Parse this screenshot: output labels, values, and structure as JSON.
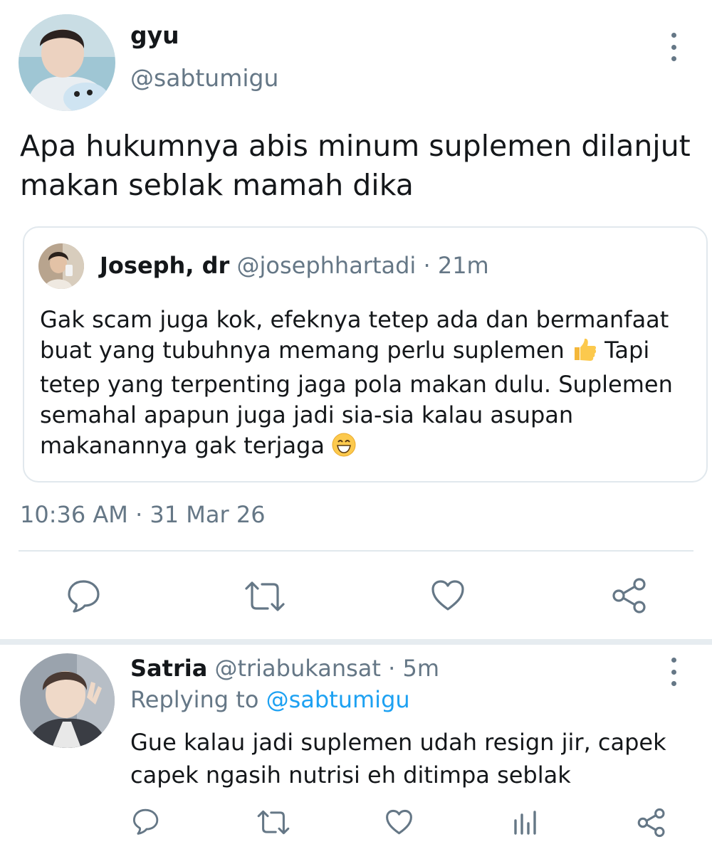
{
  "main_tweet": {
    "display_name": "gyu",
    "handle": "@sabtumigu",
    "text": "Apa hukumnya abis minum suplemen dilanjut makan seblak mamah dika",
    "timestamp": "10:36 AM · 31 Mar 26"
  },
  "quoted_tweet": {
    "display_name": "Joseph, dr",
    "handle": "@josephhartadi",
    "separator": " · ",
    "time_ago": "21m",
    "text_part1": "Gak scam juga kok, efeknya tetep ada dan bermanfaat buat yang tubuhnya memang perlu suplemen ",
    "emoji_1": "thumbs-up-emoji",
    "text_part2": " Tapi tetep yang terpenting jaga pola makan dulu. Suplemen semahal apapun juga jadi sia-sia kalau asupan makanannya gak terjaga ",
    "emoji_2": "grinning-face-emoji"
  },
  "reply_tweet": {
    "display_name": "Satria",
    "handle": "@triabukansat",
    "separator": " · ",
    "time_ago": "5m",
    "replying_prefix": "Replying to ",
    "replying_handle": "@sabtumigu",
    "text": "Gue kalau jadi suplemen udah resign jir, capek capek ngasih nutrisi eh ditimpa seblak"
  },
  "icons": {
    "reply": "reply-icon",
    "retweet": "retweet-icon",
    "like": "heart-icon",
    "share": "share-icon",
    "analytics": "analytics-icon",
    "more": "more-vertical-icon"
  },
  "colors": {
    "text_primary": "#14171a",
    "text_secondary": "#657786",
    "link": "#1da1f2",
    "border": "#e1e8ed",
    "section_bg": "#e6ecf0"
  }
}
